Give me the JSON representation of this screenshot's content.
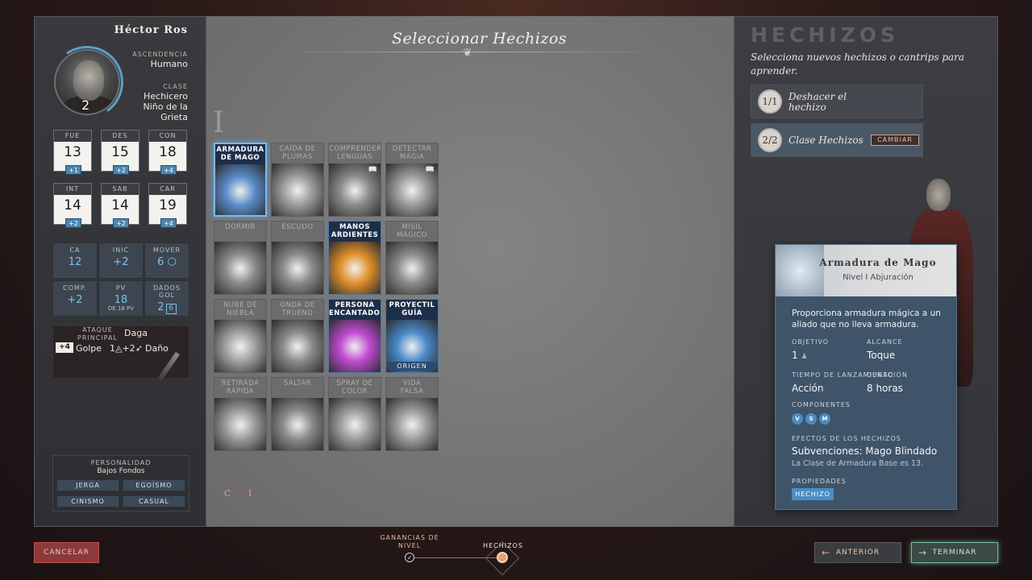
{
  "character": {
    "name": "Héctor Ros",
    "level": "2",
    "ancestry_label": "ASCENDENCIA",
    "ancestry": "Humano",
    "class_label": "CLASE",
    "class_line1": "Hechicero",
    "class_line2": "Niño de la",
    "class_line3": "Grieta"
  },
  "abilities": [
    {
      "label": "FUE",
      "value": "13",
      "mod": "+1"
    },
    {
      "label": "DES",
      "value": "15",
      "mod": "+2"
    },
    {
      "label": "CON",
      "value": "18",
      "mod": "+4"
    },
    {
      "label": "INT",
      "value": "14",
      "mod": "+2"
    },
    {
      "label": "SAB",
      "value": "14",
      "mod": "+2"
    },
    {
      "label": "CAR",
      "value": "19",
      "mod": "+4"
    }
  ],
  "derived": {
    "ca_label": "CA",
    "ca": "12",
    "inic_label": "INIC",
    "inic": "+2",
    "mover_label": "MOVER",
    "mover": "6",
    "comp_label": "COMP.",
    "comp": "+2",
    "pv_label": "PV",
    "pv": "18",
    "pv_sub": "DE 18 PV",
    "dados_label": "DADOS GOL",
    "dados": "2",
    "dados_die": "6"
  },
  "attack": {
    "label_line1": "ATAQUE",
    "label_line2": "PRINCIPAL",
    "weapon": "Daga",
    "bonus": "+4",
    "hit": "Golpe",
    "dice": "1",
    "dice_bonus": "+2",
    "damage": "Daño"
  },
  "personality": {
    "label": "PERSONALIDAD",
    "background": "Bajos Fondos",
    "traits": [
      "JERGA",
      "EGOÍSMO",
      "CINISMO",
      "CASUAL"
    ]
  },
  "center": {
    "title": "Seleccionar Hechizos",
    "level_numeral": "I",
    "filter_c": "C",
    "filter_i": "I",
    "spells": [
      {
        "l1": "ARMADURA",
        "l2": "DE MAGO",
        "known": true,
        "selected": true,
        "art": "#5a8cc8"
      },
      {
        "l1": "CAÍDA DE",
        "l2": "PLUMAS",
        "known": false,
        "art": "#9a9a9a"
      },
      {
        "l1": "COMPRENDER",
        "l2": "LENGUAS",
        "known": false,
        "book": true,
        "art": "#8a8a8a"
      },
      {
        "l1": "DETECTAR",
        "l2": "MAGIA",
        "known": false,
        "book": true,
        "art": "#9a9a9a"
      },
      {
        "l1": "DORMIR",
        "l2": "",
        "known": false,
        "art": "#8a8a8a"
      },
      {
        "l1": "ESCUDO",
        "l2": "",
        "known": false,
        "art": "#8a8a8a"
      },
      {
        "l1": "MANOS",
        "l2": "ARDIENTES",
        "known": true,
        "art": "#e0902a"
      },
      {
        "l1": "MISIL",
        "l2": "MÁGICO",
        "known": false,
        "art": "#8a8a8a"
      },
      {
        "l1": "NUBE DE",
        "l2": "NIEBLA",
        "known": false,
        "art": "#a0a0a0"
      },
      {
        "l1": "ONDA DE",
        "l2": "TRUENO",
        "known": false,
        "art": "#8a8a8a"
      },
      {
        "l1": "PERSONA",
        "l2": "ENCANTADORA",
        "known": true,
        "art": "#c04ad0"
      },
      {
        "l1": "PROYECTIL",
        "l2": "GUÍA",
        "known": true,
        "art": "#4a8ac8",
        "tag": "ORIGEN"
      },
      {
        "l1": "RETIRADA",
        "l2": "RÁPIDA",
        "known": false,
        "art": "#9a9a9a"
      },
      {
        "l1": "SALTAR",
        "l2": "",
        "known": false,
        "art": "#8a8a8a"
      },
      {
        "l1": "SPRAY DE",
        "l2": "COLOR",
        "known": false,
        "art": "#9a9a9a"
      },
      {
        "l1": "VIDA",
        "l2": "FALSA",
        "known": false,
        "art": "#9a9a9a"
      }
    ]
  },
  "right": {
    "title": "HECHIZOS",
    "subtitle": "Selecciona nuevos hechizos o cantrips para aprender.",
    "undo_badge": "1/1",
    "undo_line1": "Deshacer el",
    "undo_line2": "hechizo",
    "class_badge": "2/2",
    "class_label": "Clase Hechizos",
    "change_button": "CAMBIAR"
  },
  "tooltip": {
    "name": "Armadura de Mago",
    "level": "Nivel I Abjuración",
    "description": "Proporciona armadura mágica a un aliado que no lleva armadura.",
    "target_label": "OBJETIVO",
    "target": "1",
    "range_label": "ALCANCE",
    "range": "Toque",
    "cast_label": "TIEMPO DE LANZAMIENTO",
    "cast": "Acción",
    "duration_label": "DURACIÓN",
    "duration": "8 horas",
    "components_label": "COMPONENTES",
    "components": [
      "V",
      "S",
      "M"
    ],
    "effects_label": "EFECTOS DE LOS HECHIZOS",
    "effect_title": "Subvenciones: Mago Blindado",
    "effect_desc": "La Clase de Armadura Base es 13.",
    "props_label": "PROPIEDADES",
    "prop_tag": "HECHIZO"
  },
  "footer": {
    "cancel": "CANCELAR",
    "prev": "ANTERIOR",
    "finish": "TERMINAR",
    "step1_line1": "GANANCIAS DE",
    "step1_line2": "NIVEL",
    "step2": "HECHIZOS"
  },
  "colors": {
    "accent_blue": "#4a8cc4",
    "accent_orange": "#e8a070",
    "cancel_red": "#8a3a3a",
    "finish_green": "#7ab8a0"
  }
}
